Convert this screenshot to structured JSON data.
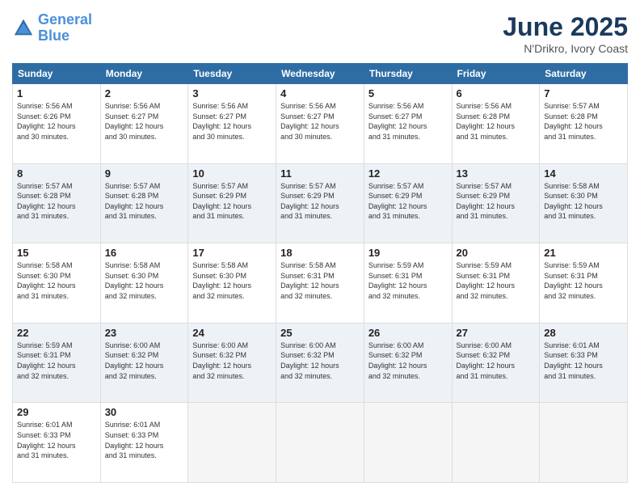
{
  "header": {
    "logo_line1": "General",
    "logo_line2": "Blue",
    "month": "June 2025",
    "location": "N'Drikro, Ivory Coast"
  },
  "weekdays": [
    "Sunday",
    "Monday",
    "Tuesday",
    "Wednesday",
    "Thursday",
    "Friday",
    "Saturday"
  ],
  "weeks": [
    [
      {
        "day": "1",
        "info": "Sunrise: 5:56 AM\nSunset: 6:26 PM\nDaylight: 12 hours\nand 30 minutes."
      },
      {
        "day": "2",
        "info": "Sunrise: 5:56 AM\nSunset: 6:27 PM\nDaylight: 12 hours\nand 30 minutes."
      },
      {
        "day": "3",
        "info": "Sunrise: 5:56 AM\nSunset: 6:27 PM\nDaylight: 12 hours\nand 30 minutes."
      },
      {
        "day": "4",
        "info": "Sunrise: 5:56 AM\nSunset: 6:27 PM\nDaylight: 12 hours\nand 30 minutes."
      },
      {
        "day": "5",
        "info": "Sunrise: 5:56 AM\nSunset: 6:27 PM\nDaylight: 12 hours\nand 31 minutes."
      },
      {
        "day": "6",
        "info": "Sunrise: 5:56 AM\nSunset: 6:28 PM\nDaylight: 12 hours\nand 31 minutes."
      },
      {
        "day": "7",
        "info": "Sunrise: 5:57 AM\nSunset: 6:28 PM\nDaylight: 12 hours\nand 31 minutes."
      }
    ],
    [
      {
        "day": "8",
        "info": "Sunrise: 5:57 AM\nSunset: 6:28 PM\nDaylight: 12 hours\nand 31 minutes."
      },
      {
        "day": "9",
        "info": "Sunrise: 5:57 AM\nSunset: 6:28 PM\nDaylight: 12 hours\nand 31 minutes."
      },
      {
        "day": "10",
        "info": "Sunrise: 5:57 AM\nSunset: 6:29 PM\nDaylight: 12 hours\nand 31 minutes."
      },
      {
        "day": "11",
        "info": "Sunrise: 5:57 AM\nSunset: 6:29 PM\nDaylight: 12 hours\nand 31 minutes."
      },
      {
        "day": "12",
        "info": "Sunrise: 5:57 AM\nSunset: 6:29 PM\nDaylight: 12 hours\nand 31 minutes."
      },
      {
        "day": "13",
        "info": "Sunrise: 5:57 AM\nSunset: 6:29 PM\nDaylight: 12 hours\nand 31 minutes."
      },
      {
        "day": "14",
        "info": "Sunrise: 5:58 AM\nSunset: 6:30 PM\nDaylight: 12 hours\nand 31 minutes."
      }
    ],
    [
      {
        "day": "15",
        "info": "Sunrise: 5:58 AM\nSunset: 6:30 PM\nDaylight: 12 hours\nand 31 minutes."
      },
      {
        "day": "16",
        "info": "Sunrise: 5:58 AM\nSunset: 6:30 PM\nDaylight: 12 hours\nand 32 minutes."
      },
      {
        "day": "17",
        "info": "Sunrise: 5:58 AM\nSunset: 6:30 PM\nDaylight: 12 hours\nand 32 minutes."
      },
      {
        "day": "18",
        "info": "Sunrise: 5:58 AM\nSunset: 6:31 PM\nDaylight: 12 hours\nand 32 minutes."
      },
      {
        "day": "19",
        "info": "Sunrise: 5:59 AM\nSunset: 6:31 PM\nDaylight: 12 hours\nand 32 minutes."
      },
      {
        "day": "20",
        "info": "Sunrise: 5:59 AM\nSunset: 6:31 PM\nDaylight: 12 hours\nand 32 minutes."
      },
      {
        "day": "21",
        "info": "Sunrise: 5:59 AM\nSunset: 6:31 PM\nDaylight: 12 hours\nand 32 minutes."
      }
    ],
    [
      {
        "day": "22",
        "info": "Sunrise: 5:59 AM\nSunset: 6:31 PM\nDaylight: 12 hours\nand 32 minutes."
      },
      {
        "day": "23",
        "info": "Sunrise: 6:00 AM\nSunset: 6:32 PM\nDaylight: 12 hours\nand 32 minutes."
      },
      {
        "day": "24",
        "info": "Sunrise: 6:00 AM\nSunset: 6:32 PM\nDaylight: 12 hours\nand 32 minutes."
      },
      {
        "day": "25",
        "info": "Sunrise: 6:00 AM\nSunset: 6:32 PM\nDaylight: 12 hours\nand 32 minutes."
      },
      {
        "day": "26",
        "info": "Sunrise: 6:00 AM\nSunset: 6:32 PM\nDaylight: 12 hours\nand 32 minutes."
      },
      {
        "day": "27",
        "info": "Sunrise: 6:00 AM\nSunset: 6:32 PM\nDaylight: 12 hours\nand 31 minutes."
      },
      {
        "day": "28",
        "info": "Sunrise: 6:01 AM\nSunset: 6:33 PM\nDaylight: 12 hours\nand 31 minutes."
      }
    ],
    [
      {
        "day": "29",
        "info": "Sunrise: 6:01 AM\nSunset: 6:33 PM\nDaylight: 12 hours\nand 31 minutes."
      },
      {
        "day": "30",
        "info": "Sunrise: 6:01 AM\nSunset: 6:33 PM\nDaylight: 12 hours\nand 31 minutes."
      },
      {
        "day": "",
        "info": ""
      },
      {
        "day": "",
        "info": ""
      },
      {
        "day": "",
        "info": ""
      },
      {
        "day": "",
        "info": ""
      },
      {
        "day": "",
        "info": ""
      }
    ]
  ]
}
